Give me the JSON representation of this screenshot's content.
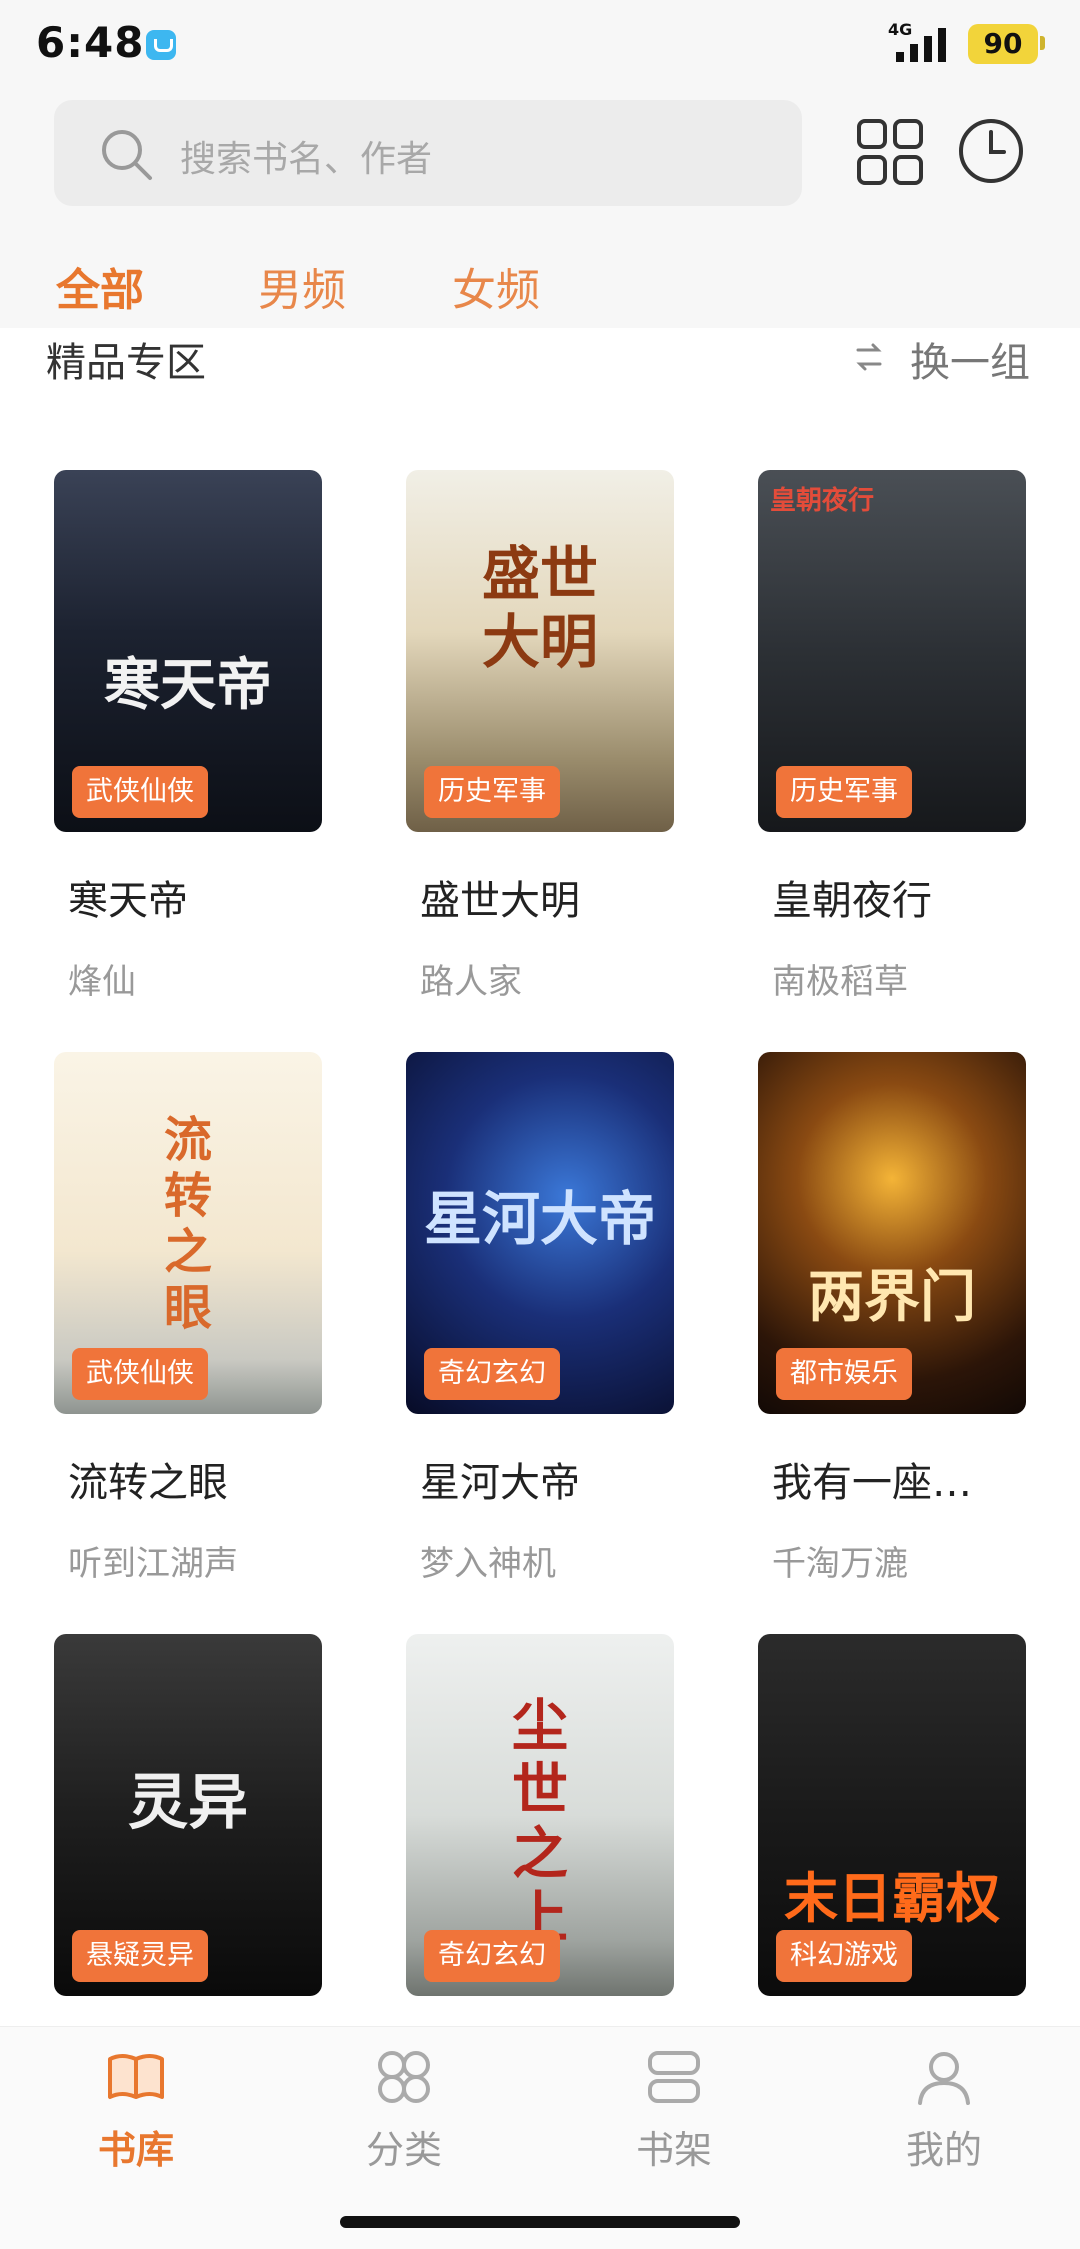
{
  "status_bar": {
    "time": "6:48",
    "network": "4G",
    "battery": "90"
  },
  "search": {
    "placeholder": "搜索书名、作者"
  },
  "tabs": [
    {
      "label": "全部",
      "active": true
    },
    {
      "label": "男频",
      "active": false
    },
    {
      "label": "女频",
      "active": false
    }
  ],
  "section": {
    "title": "精品专区",
    "refresh_label": "换一组"
  },
  "books": [
    {
      "title": "寒天帝",
      "author": "烽仙",
      "genre": "武侠仙侠",
      "cover_text": "寒天帝"
    },
    {
      "title": "盛世大明",
      "author": "路人家",
      "genre": "历史军事",
      "cover_text": "盛世大明"
    },
    {
      "title": "皇朝夜行",
      "author": "南极稻草",
      "genre": "历史军事",
      "cover_text": "皇朝夜行"
    },
    {
      "title": "流转之眼",
      "author": "听到江湖声",
      "genre": "武侠仙侠",
      "cover_text": "流转之眼"
    },
    {
      "title": "星河大帝",
      "author": "梦入神机",
      "genre": "奇幻玄幻",
      "cover_text": "星河大帝"
    },
    {
      "title": "我有一座…",
      "author": "千淘万漉",
      "genre": "都市娱乐",
      "cover_text": "两界门"
    },
    {
      "title": "",
      "author": "",
      "genre": "悬疑灵异",
      "cover_text": "灵异"
    },
    {
      "title": "",
      "author": "",
      "genre": "奇幻玄幻",
      "cover_text": "尘世之上"
    },
    {
      "title": "",
      "author": "",
      "genre": "科幻游戏",
      "cover_text": "末日霸权"
    }
  ],
  "nav": [
    {
      "label": "书库",
      "icon": "book-icon",
      "active": true
    },
    {
      "label": "分类",
      "icon": "category-icon",
      "active": false
    },
    {
      "label": "书架",
      "icon": "bookshelf-icon",
      "active": false
    },
    {
      "label": "我的",
      "icon": "profile-icon",
      "active": false
    }
  ],
  "colors": {
    "accent": "#e8772e",
    "tag": "#f0743a"
  }
}
